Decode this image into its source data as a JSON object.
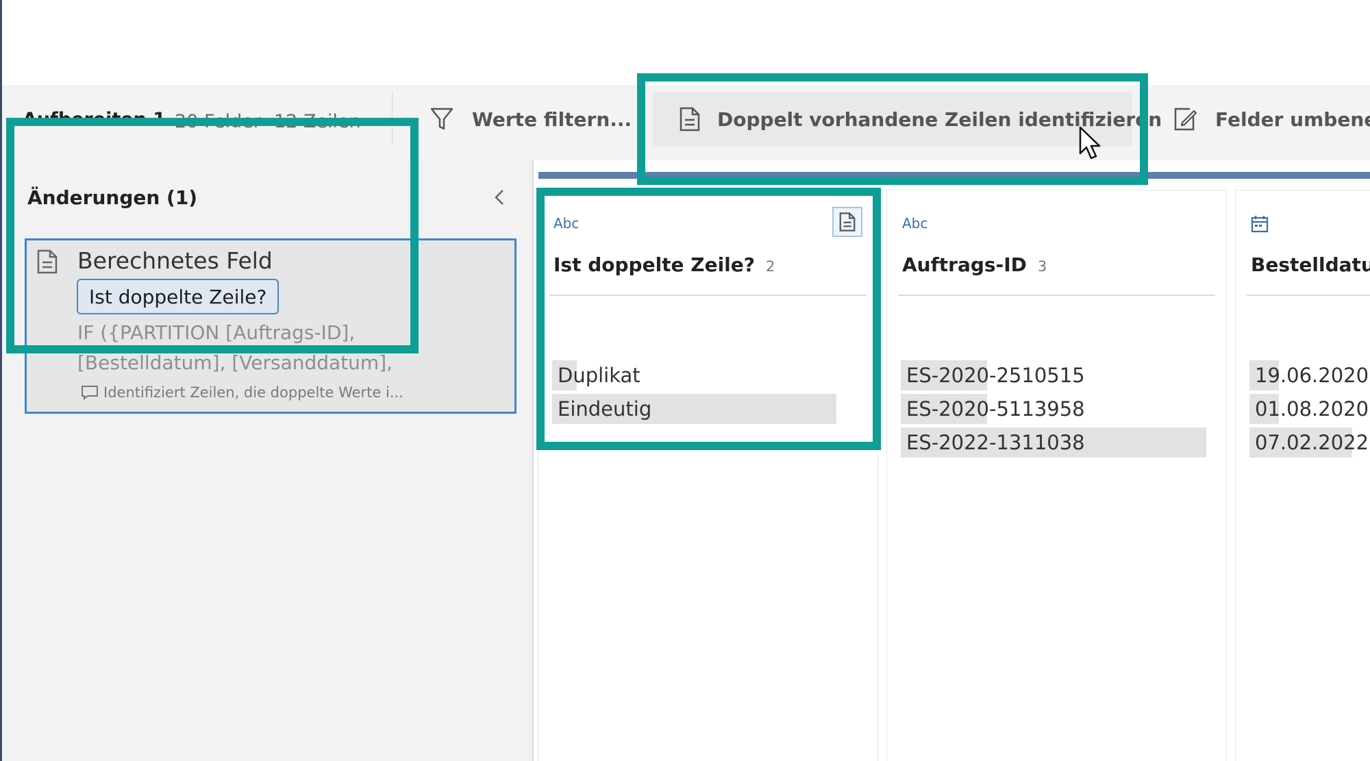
{
  "toolbar": {
    "step_name": "Aufbereiten 1",
    "fields_count": "20 Felder",
    "rows_count": "12 Zeilen",
    "filter_label": "Werte filtern...",
    "duplicate_label": "Doppelt vorhandene Zeilen identifizieren",
    "rename_label": "Felder umbenenn"
  },
  "changes_panel": {
    "title": "Änderungen (1)",
    "card": {
      "title": "Berechnetes Feld",
      "field_name": "Ist doppelte Zeile?",
      "formula_line1": "IF ({PARTITION [Auftrags-ID],",
      "formula_line2": "[Bestelldatum], [Versanddatum],",
      "comment": "Identifiziert Zeilen, die doppelte Werte i..."
    }
  },
  "columns": [
    {
      "type": "Abc",
      "name": "Ist doppelte Zeile?",
      "count": "2",
      "values": [
        {
          "label": "Duplikat",
          "share": 0.08
        },
        {
          "label": "Eindeutig",
          "share": 0.92
        }
      ]
    },
    {
      "type": "Abc",
      "name": "Auftrags-ID",
      "count": "3",
      "values": [
        {
          "label": "ES-2020-2510515",
          "share": 0.28
        },
        {
          "label": "ES-2020-5113958",
          "share": 0.28
        },
        {
          "label": "ES-2022-1311038",
          "share": 0.99
        }
      ]
    },
    {
      "type_icon": "calendar-icon",
      "name": "Bestelldatum",
      "values": [
        {
          "label": "19.06.2020",
          "share": 0.28
        },
        {
          "label": "01.08.2020",
          "share": 0.28
        },
        {
          "label": "07.02.2022",
          "share": 0.99
        }
      ]
    }
  ],
  "colors": {
    "highlight": "#0f9e96",
    "selection_border": "#3e86d1",
    "accent_bar": "#5b7fa8",
    "type_label": "#3a6ea5"
  }
}
